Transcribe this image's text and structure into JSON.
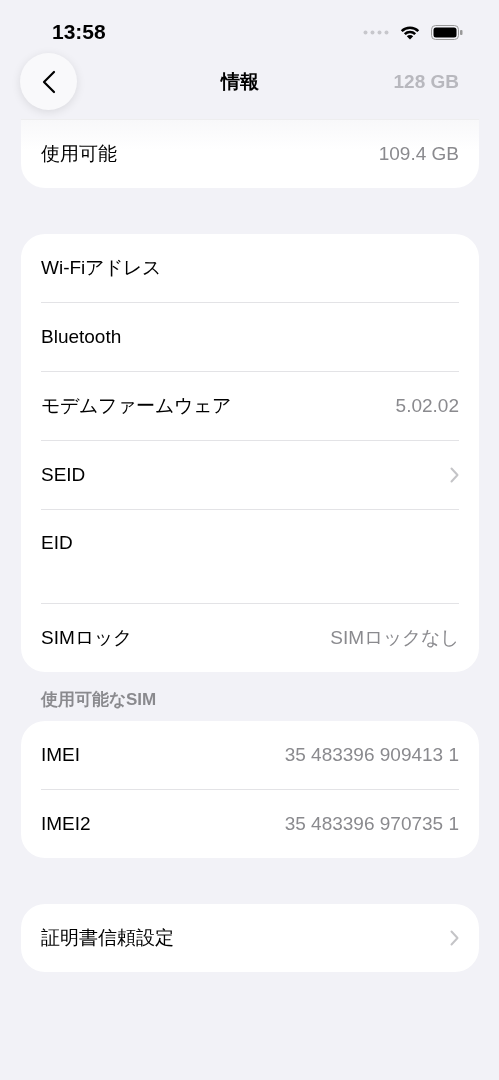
{
  "status_bar": {
    "time": "13:58"
  },
  "nav": {
    "title": "情報",
    "behind_value": "128 GB"
  },
  "sections": [
    {
      "rows": [
        {
          "label": "使用可能",
          "value": "109.4 GB",
          "kind": "value"
        }
      ]
    },
    {
      "rows": [
        {
          "label": "Wi-Fiアドレス",
          "kind": "hidden"
        },
        {
          "label": "Bluetooth",
          "kind": "hidden"
        },
        {
          "label": "モデムファームウェア",
          "value": "5.02.02",
          "kind": "value"
        },
        {
          "label": "SEID",
          "kind": "chevron"
        },
        {
          "label": "EID",
          "kind": "stacked"
        },
        {
          "label": "SIMロック",
          "value": "SIMロックなし",
          "kind": "value"
        }
      ]
    },
    {
      "header": "使用可能なSIM",
      "rows": [
        {
          "label": "IMEI",
          "value": "35 483396 909413 1",
          "kind": "value"
        },
        {
          "label": "IMEI2",
          "value": "35 483396 970735 1",
          "kind": "value"
        }
      ]
    },
    {
      "rows": [
        {
          "label": "証明書信頼設定",
          "kind": "chevron"
        }
      ]
    }
  ]
}
